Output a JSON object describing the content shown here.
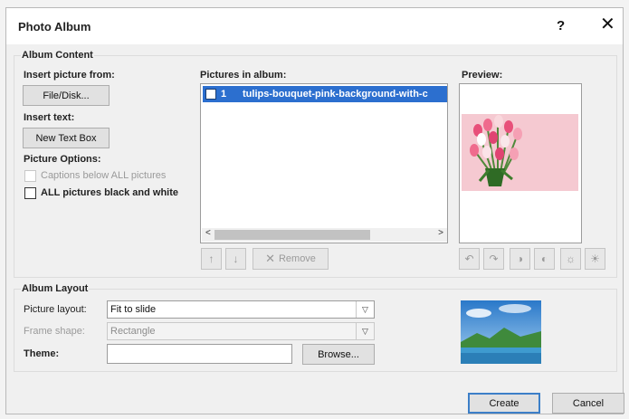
{
  "window": {
    "title": "Photo Album",
    "help": "?",
    "close": "✕"
  },
  "album_content": {
    "heading": "Album Content",
    "insert_picture_label": "Insert picture from:",
    "file_disk_button": "File/Disk...",
    "insert_text_label": "Insert text:",
    "new_text_box_button": "New Text Box",
    "picture_options_label": "Picture Options:",
    "captions_option": "Captions below ALL pictures",
    "bw_option": "ALL pictures black and white",
    "pictures_label": "Pictures in album:",
    "pictures": [
      {
        "index": "1",
        "name": "tulips-bouquet-pink-background-with-c",
        "selected": true,
        "checked": false
      }
    ],
    "preview_label": "Preview:",
    "remove_button": "Remove",
    "up_glyph": "↑",
    "down_glyph": "↓",
    "remove_glyph": "✕",
    "scroll_left": "<",
    "scroll_right": ">"
  },
  "album_layout": {
    "heading": "Album Layout",
    "picture_layout_label": "Picture layout:",
    "picture_layout_value": "Fit to slide",
    "frame_shape_label": "Frame shape:",
    "frame_shape_value": "Rectangle",
    "theme_label": "Theme:",
    "theme_value": "",
    "browse_button": "Browse...",
    "dropdown_glyph": "▽"
  },
  "footer": {
    "create_button": "Create",
    "cancel_button": "Cancel"
  },
  "colors": {
    "selection": "#2c6fcf",
    "preview_bg": "#f5c9d1",
    "primary_border": "#3c7fc8"
  }
}
